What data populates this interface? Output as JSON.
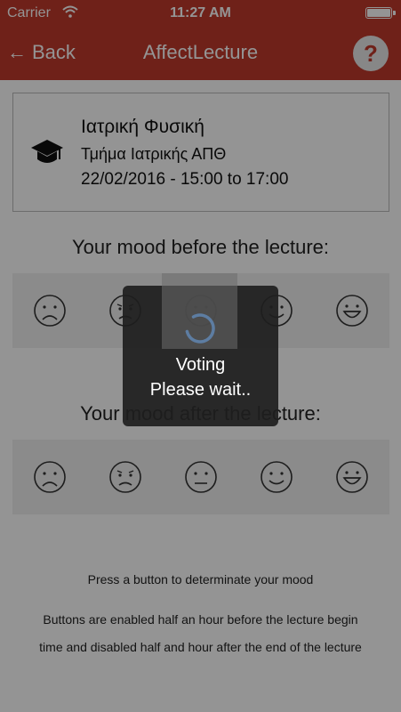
{
  "status_bar": {
    "carrier": "Carrier",
    "time": "11:27 AM"
  },
  "nav": {
    "back_label": "Back",
    "title": "AffectLecture",
    "help_label": "?"
  },
  "lecture": {
    "title": "Ιατρική Φυσική",
    "department": "Τμήμα Ιατρικής ΑΠΘ",
    "datetime": "22/02/2016 - 15:00 to 17:00",
    "icon": "graduation-cap-icon"
  },
  "mood_before": {
    "heading": "Your mood before the lecture:",
    "options": [
      "very-sad-face-icon",
      "sad-face-icon",
      "neutral-face-icon",
      "happy-face-icon",
      "very-happy-face-icon"
    ]
  },
  "mood_after": {
    "heading": "Your mood after the lecture:",
    "options": [
      "very-sad-face-icon",
      "sad-face-icon",
      "neutral-face-icon",
      "happy-face-icon",
      "very-happy-face-icon"
    ]
  },
  "info": {
    "line1": "Press a button to determinate your mood",
    "line2": "Buttons are enabled half an hour before the lecture begin",
    "line3": "time and disabled half and hour after the end of the lecture"
  },
  "loading": {
    "line1": "Voting",
    "line2": "Please wait.."
  },
  "colors": {
    "brand": "#c0392b",
    "spinner": "#4a90e2"
  }
}
